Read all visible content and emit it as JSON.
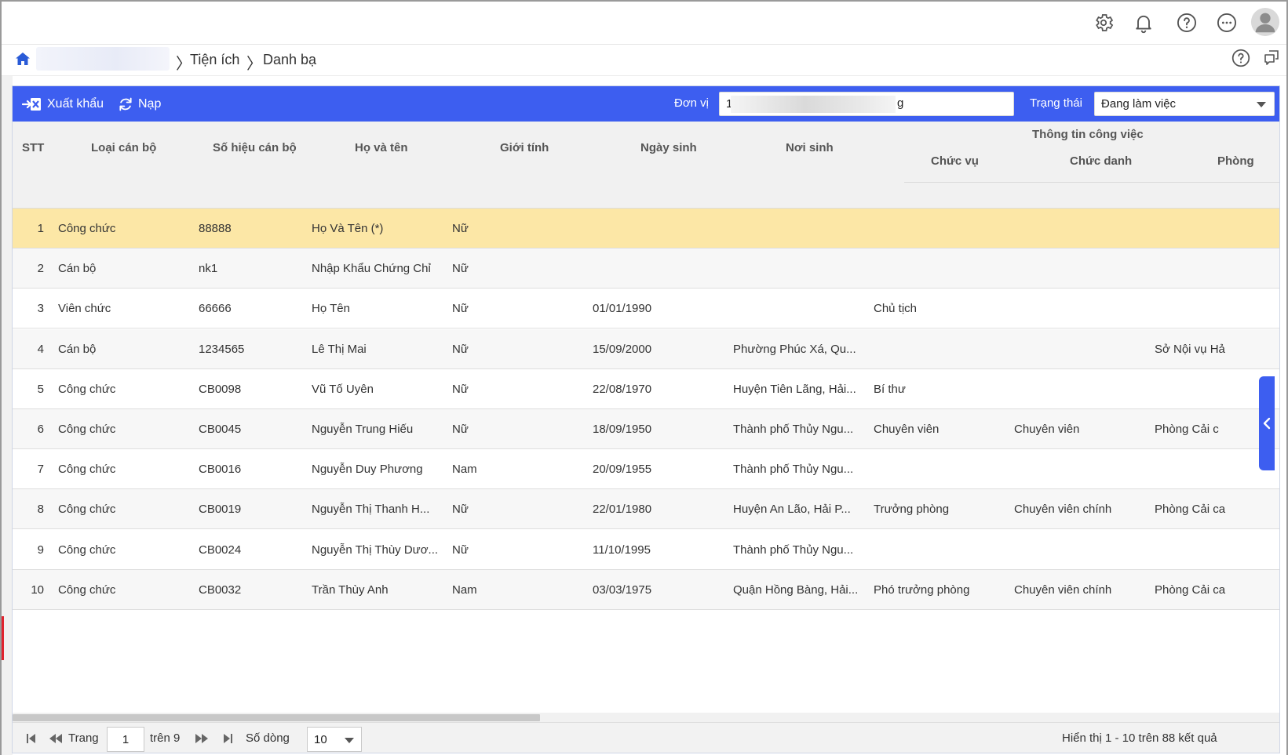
{
  "topbar": {
    "icons": [
      "gear-icon",
      "bell-icon",
      "help-icon",
      "more-icon",
      "avatar"
    ]
  },
  "breadcrumb": {
    "items": [
      "Tiện ích",
      "Danh bạ"
    ]
  },
  "toolbar": {
    "export_label": "Xuất khẩu",
    "reload_label": "Nạp",
    "unit_label": "Đơn vị",
    "unit_value_prefix": "1",
    "unit_value_suffix": "g",
    "status_label": "Trạng thái",
    "status_value": "Đang làm việc"
  },
  "table": {
    "headers": {
      "stt": "STT",
      "type": "Loại cán bộ",
      "code": "Số hiệu cán bộ",
      "name": "Họ và tên",
      "gender": "Giới tính",
      "dob": "Ngày sinh",
      "birthplace": "Nơi sinh",
      "job_group": "Thông tin công việc",
      "position": "Chức vụ",
      "title": "Chức danh",
      "department": "Phòng"
    },
    "rows": [
      {
        "stt": "1",
        "type": "Công chức",
        "code": "88888",
        "name": "Họ Và Tên (*)",
        "gender": "Nữ",
        "dob": "",
        "birthplace": "",
        "position": "",
        "title": "",
        "department": ""
      },
      {
        "stt": "2",
        "type": "Cán bộ",
        "code": "nk1",
        "name": "Nhập Khẩu Chứng Chỉ",
        "gender": "Nữ",
        "dob": "",
        "birthplace": "",
        "position": "",
        "title": "",
        "department": ""
      },
      {
        "stt": "3",
        "type": "Viên chức",
        "code": "66666",
        "name": "Họ Tên",
        "gender": "Nữ",
        "dob": "01/01/1990",
        "birthplace": "",
        "position": "Chủ tịch",
        "title": "",
        "department": ""
      },
      {
        "stt": "4",
        "type": "Cán bộ",
        "code": "1234565",
        "name": "Lê Thị Mai",
        "gender": "Nữ",
        "dob": "15/09/2000",
        "birthplace": "Phường Phúc Xá, Qu...",
        "position": "",
        "title": "",
        "department": "Sở Nội vụ Hả"
      },
      {
        "stt": "5",
        "type": "Công chức",
        "code": "CB0098",
        "name": "Vũ Tố Uyên",
        "gender": "Nữ",
        "dob": "22/08/1970",
        "birthplace": "Huyện Tiên Lãng, Hải...",
        "position": "Bí thư",
        "title": "",
        "department": ""
      },
      {
        "stt": "6",
        "type": "Công chức",
        "code": "CB0045",
        "name": "Nguyễn Trung Hiếu",
        "gender": "Nữ",
        "dob": "18/09/1950",
        "birthplace": "Thành phố Thủy Ngu...",
        "position": "Chuyên viên",
        "title": "Chuyên viên",
        "department": "Phòng Cải c"
      },
      {
        "stt": "7",
        "type": "Công chức",
        "code": "CB0016",
        "name": "Nguyễn Duy Phương",
        "gender": "Nam",
        "dob": "20/09/1955",
        "birthplace": "Thành phố Thủy Ngu...",
        "position": "",
        "title": "",
        "department": ""
      },
      {
        "stt": "8",
        "type": "Công chức",
        "code": "CB0019",
        "name": "Nguyễn Thị Thanh H...",
        "gender": "Nữ",
        "dob": "22/01/1980",
        "birthplace": "Huyện An Lão, Hải P...",
        "position": "Trưởng phòng",
        "title": "Chuyên viên chính",
        "department": "Phòng Cải ca"
      },
      {
        "stt": "9",
        "type": "Công chức",
        "code": "CB0024",
        "name": "Nguyễn Thị Thùy Dươ...",
        "gender": "Nữ",
        "dob": "11/10/1995",
        "birthplace": "Thành phố Thủy Ngu...",
        "position": "",
        "title": "",
        "department": ""
      },
      {
        "stt": "10",
        "type": "Công chức",
        "code": "CB0032",
        "name": "Trần Thùy Anh",
        "gender": "Nam",
        "dob": "03/03/1975",
        "birthplace": "Quận Hồng Bàng, Hải...",
        "position": "Phó trưởng phòng",
        "title": "Chuyên viên chính",
        "department": "Phòng Cải ca"
      }
    ]
  },
  "pager": {
    "page_label": "Trang",
    "page_value": "1",
    "of_label": "trên 9",
    "rows_label": "Số dòng",
    "rows_value": "10",
    "summary": "Hiển thị 1 - 10 trên 88 kết quả"
  },
  "colors": {
    "accent": "#3d5ef0",
    "selected_row": "#fce7a6",
    "highlight_frame": "#e0242f"
  }
}
